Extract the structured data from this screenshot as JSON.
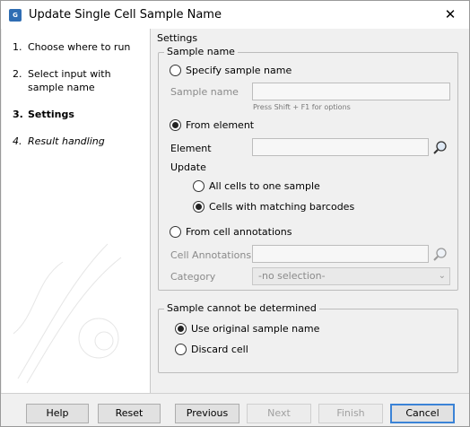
{
  "window": {
    "title": "Update Single Cell Sample Name",
    "icon": "app-icon",
    "close_glyph": "✕"
  },
  "steps": [
    {
      "num": "1.",
      "label": "Choose where to run"
    },
    {
      "num": "2.",
      "label": "Select input with sample name"
    },
    {
      "num": "3.",
      "label": "Settings"
    },
    {
      "num": "4.",
      "label": "Result handling"
    }
  ],
  "settings": {
    "section_label": "Settings",
    "sample_name_group": {
      "title": "Sample name",
      "specify_option": "Specify sample name",
      "sample_name_label": "Sample name",
      "sample_name_value": "",
      "sample_name_hint": "Press Shift + F1 for options",
      "from_element_option": "From element",
      "element_label": "Element",
      "element_value": "",
      "update_label": "Update",
      "update_all_cells": "All cells to one sample",
      "update_matching": "Cells with matching barcodes",
      "from_annotations_option": "From cell annotations",
      "cell_annotations_label": "Cell Annotations",
      "cell_annotations_value": "",
      "category_label": "Category",
      "category_selected": "-no selection-"
    },
    "undetermined_group": {
      "title": "Sample cannot be determined",
      "use_original": "Use original sample name",
      "discard_cell": "Discard cell"
    }
  },
  "footer": {
    "help": "Help",
    "reset": "Reset",
    "previous": "Previous",
    "next": "Next",
    "finish": "Finish",
    "cancel": "Cancel"
  }
}
